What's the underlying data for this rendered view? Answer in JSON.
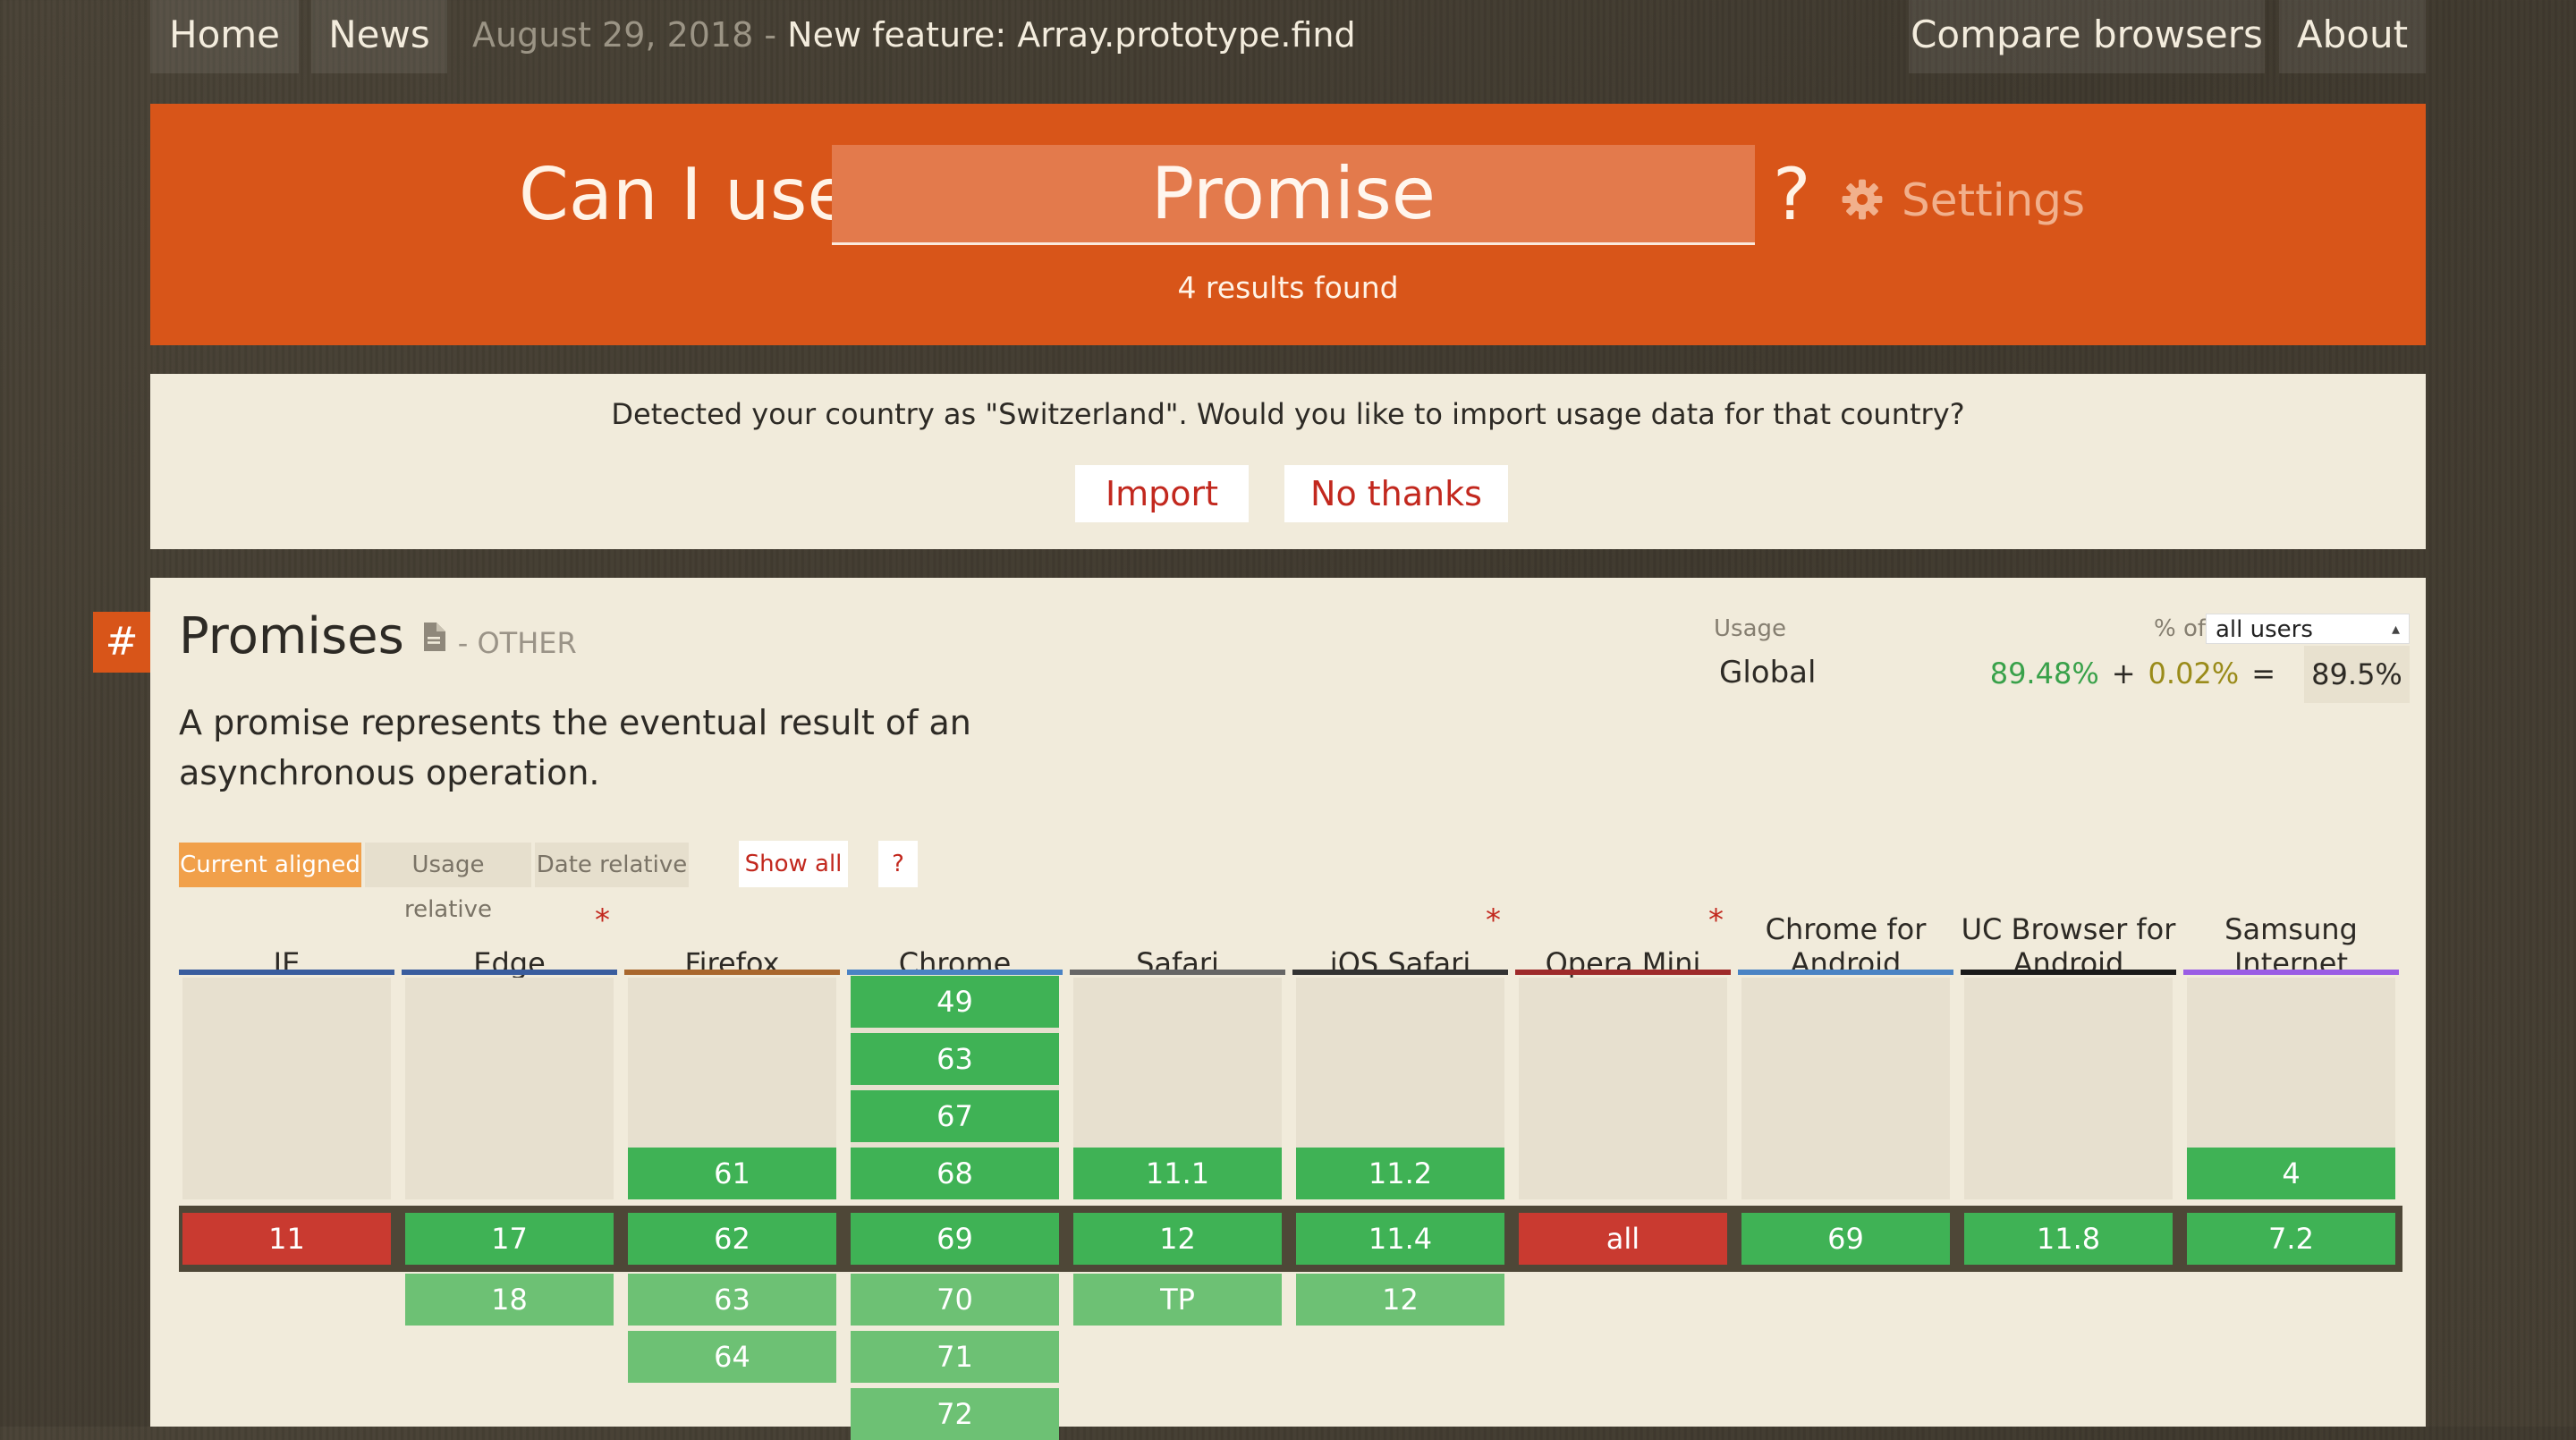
{
  "nav": {
    "home": "Home",
    "news": "News",
    "news_date": "August 29, 2018",
    "news_sep": " - ",
    "news_title": "New feature: Array.prototype.find",
    "compare": "Compare browsers",
    "about": "About"
  },
  "search": {
    "prefix": "Can I use",
    "value": "Promise",
    "suffix": "?",
    "settings": "Settings",
    "results": "4 results found"
  },
  "notice": {
    "text": "Detected your country as \"Switzerland\". Would you like to import usage data for that country?",
    "import": "Import",
    "no_thanks": "No thanks"
  },
  "feature": {
    "anchor": "#",
    "title": "Promises",
    "category": "- OTHER",
    "description": "A promise represents the eventual result of an asynchronous operation.",
    "usage_label": "Usage",
    "pct_of": "% of",
    "users_select": "all users",
    "region": "Global",
    "supported": "89.48%",
    "plus": "+",
    "partial": "0.02%",
    "equals": "=",
    "total": "89.5%",
    "tabs": {
      "current": "Current aligned",
      "usage": "Usage relative",
      "date": "Date relative"
    },
    "show_all": "Show all",
    "help": "?"
  },
  "colors": {
    "accent": "#d85519",
    "supported": "#3fb255",
    "unsupported": "#c93a30",
    "background": "#f1ebdb"
  },
  "browsers": [
    {
      "name": "IE",
      "star": "",
      "color": "#3a5d9e",
      "past": [],
      "current": {
        "v": "11",
        "s": "n"
      },
      "future": []
    },
    {
      "name": "Edge",
      "star": "*",
      "color": "#3a5d9e",
      "past": [],
      "current": {
        "v": "17",
        "s": "y"
      },
      "future": [
        "18"
      ]
    },
    {
      "name": "Firefox",
      "star": "",
      "color": "#a9672d",
      "past": [
        "61"
      ],
      "current": {
        "v": "62",
        "s": "y"
      },
      "future": [
        "63",
        "64"
      ]
    },
    {
      "name": "Chrome",
      "star": "",
      "color": "#4a83c4",
      "past": [
        "49",
        "63",
        "67",
        "68"
      ],
      "current": {
        "v": "69",
        "s": "y"
      },
      "future": [
        "70",
        "71",
        "72"
      ]
    },
    {
      "name": "Safari",
      "star": "",
      "color": "#666666",
      "past": [
        "11.1"
      ],
      "current": {
        "v": "12",
        "s": "y"
      },
      "future": [
        "TP"
      ]
    },
    {
      "name": "iOS Safari",
      "star": "*",
      "color": "#333333",
      "past": [
        "11.2"
      ],
      "current": {
        "v": "11.4",
        "s": "y"
      },
      "future": [
        "12"
      ]
    },
    {
      "name": "Opera Mini",
      "star": "*",
      "color": "#9e2a2a",
      "past": [],
      "current": {
        "v": "all",
        "s": "n"
      },
      "future": []
    },
    {
      "name": "Chrome for Android",
      "star": "",
      "color": "#4a83c4",
      "past": [],
      "current": {
        "v": "69",
        "s": "y"
      },
      "future": []
    },
    {
      "name": "UC Browser for Android",
      "star": "",
      "color": "#1a1a1a",
      "past": [],
      "current": {
        "v": "11.8",
        "s": "y"
      },
      "future": []
    },
    {
      "name": "Samsung Internet",
      "star": "",
      "color": "#9a5de4",
      "past": [
        "4"
      ],
      "current": {
        "v": "7.2",
        "s": "y"
      },
      "future": []
    }
  ]
}
